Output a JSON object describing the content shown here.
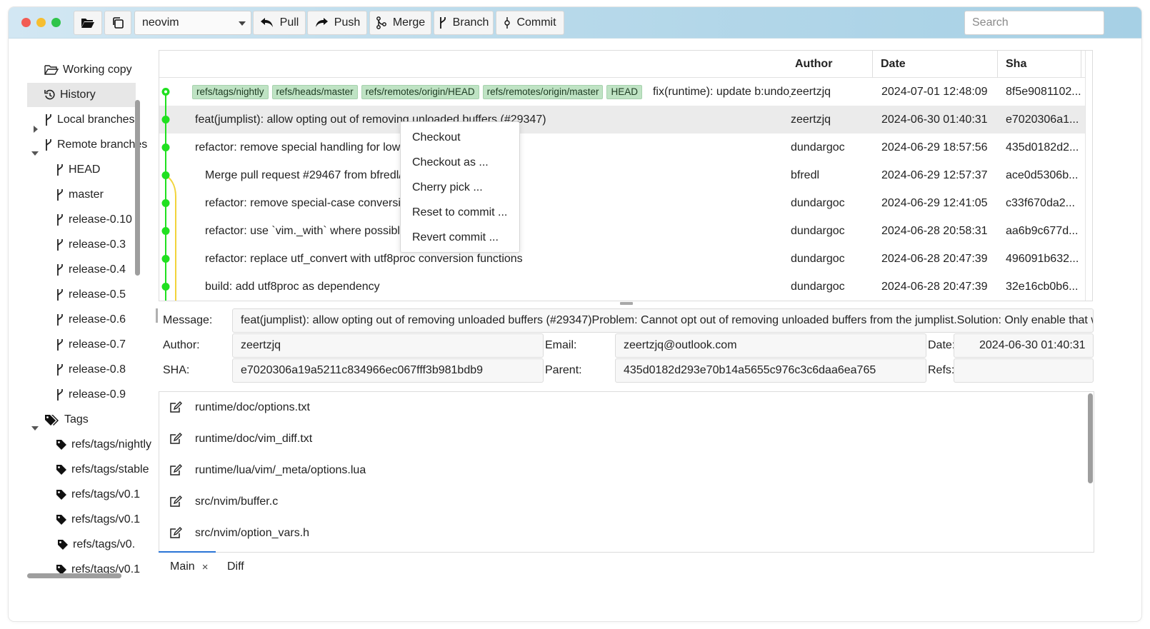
{
  "toolbar": {
    "open_icon": "folder-open-icon",
    "clone_icon": "copy-icon",
    "repo_selected": "neovim",
    "pull_label": "Pull",
    "push_label": "Push",
    "merge_label": "Merge",
    "branch_label": "Branch",
    "commit_label": "Commit",
    "search_placeholder": "Search"
  },
  "sidebar": {
    "working_copy": "Working copy",
    "history": "History",
    "local_branches": "Local branches",
    "remote_branches": "Remote branches",
    "remote_items": [
      "HEAD",
      "master",
      "release-0.10",
      "release-0.3",
      "release-0.4",
      "release-0.5",
      "release-0.6",
      "release-0.7",
      "release-0.8",
      "release-0.9"
    ],
    "tags": "Tags",
    "tag_items": [
      "refs/tags/nightly",
      "refs/tags/stable",
      "refs/tags/v0.1",
      "refs/tags/v0.1",
      "refs/tags/v0.",
      "refs/tags/v0.1"
    ]
  },
  "history": {
    "columns": {
      "author": "Author",
      "date": "Date",
      "sha": "Sha"
    },
    "rows": [
      {
        "tags": [
          "refs/tags/nightly",
          "refs/heads/master",
          "refs/remotes/origin/HEAD",
          "refs/remotes/origin/master",
          "HEAD"
        ],
        "message": "fix(runtime): update b:undo_ftplugin",
        "author": "zeertzjq",
        "date": "2024-07-01 12:48:09",
        "sha": "8f5e9081102..."
      },
      {
        "tags": [],
        "message": "feat(jumplist): allow opting out of removing unloaded buffers (#29347)",
        "author": "zeertzjq",
        "date": "2024-06-30 01:40:31",
        "sha": "e7020306a1..."
      },
      {
        "tags": [],
        "message": "refactor: remove special handling for lowercase",
        "author": "dundargoc",
        "date": "2024-06-29 18:57:56",
        "sha": "435d0182d2..."
      },
      {
        "tags": [],
        "message": "Merge pull request #29467 from bfredl/sh",
        "author": "bfredl",
        "date": "2024-06-29 12:57:37",
        "sha": "ace0d5306b..."
      },
      {
        "tags": [],
        "message": "refactor: remove special-case conversion",
        "author": "dundargoc",
        "date": "2024-06-29 12:41:05",
        "sha": "c33f670da2..."
      },
      {
        "tags": [],
        "message": "refactor: use `vim._with` where possible",
        "author": "dundargoc",
        "date": "2024-06-28 20:58:31",
        "sha": "aa6b9c677d..."
      },
      {
        "tags": [],
        "message": "refactor: replace utf_convert with utf8proc conversion functions",
        "author": "dundargoc",
        "date": "2024-06-28 20:47:39",
        "sha": "496091b632..."
      },
      {
        "tags": [],
        "message": "build: add utf8proc as dependency",
        "author": "dundargoc",
        "date": "2024-06-28 20:47:39",
        "sha": "32e16cb0b6..."
      }
    ]
  },
  "context_menu": [
    "Checkout",
    "Checkout as ...",
    "Cherry pick ...",
    "Reset to commit ...",
    "Revert commit ..."
  ],
  "details": {
    "message_label": "Message:",
    "message": "feat(jumplist): allow opting out of removing unloaded buffers (#29347)Problem:  Cannot opt out of removing unloaded buffers from the jumplist.Solution: Only enable that with \"unload\"",
    "author_label": "Author:",
    "author": "zeertzjq",
    "email_label": "Email:",
    "email": "zeertzjq@outlook.com",
    "date_label": "Date:",
    "date": "2024-06-30 01:40:31",
    "sha_label": "SHA:",
    "sha": "e7020306a19a5211c834966ec067fff3b981bdb9",
    "parent_label": "Parent:",
    "parent": "435d0182d293e70b14a5655c976c3c6daa6ea765",
    "refs_label": "Refs:",
    "refs": ""
  },
  "files": [
    "runtime/doc/options.txt",
    "runtime/doc/vim_diff.txt",
    "runtime/lua/vim/_meta/options.lua",
    "src/nvim/buffer.c",
    "src/nvim/option_vars.h"
  ],
  "tabs": {
    "main": "Main",
    "close": "×",
    "diff": "Diff"
  },
  "colors": {
    "graph_green": "#20e020",
    "graph_yellow": "#f2d43a",
    "tag_bg": "#bfe3c4",
    "accent": "#2a74d6"
  }
}
